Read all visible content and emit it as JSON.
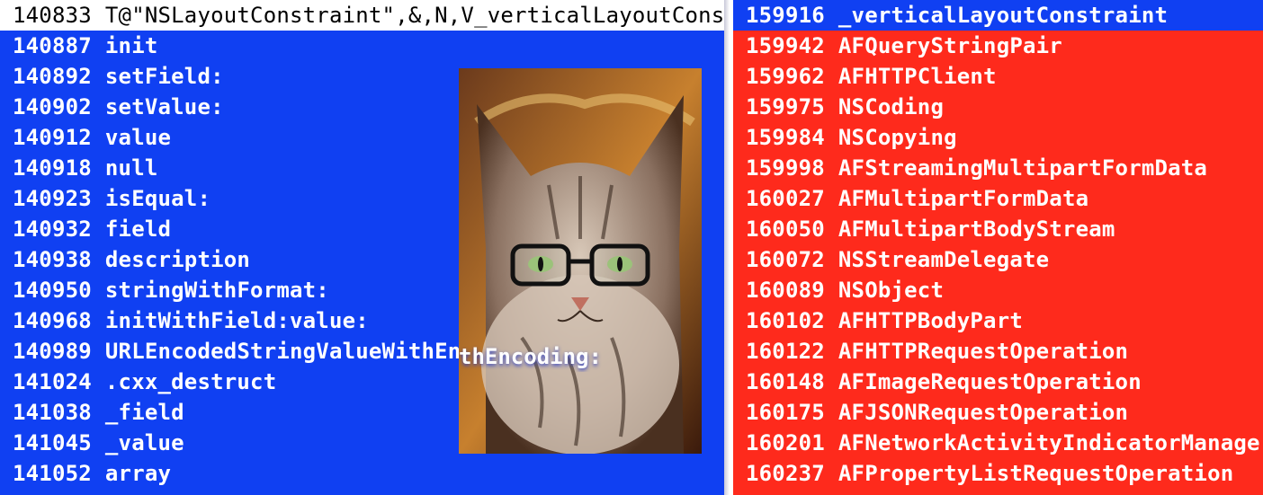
{
  "left_list": {
    "rows": [
      {
        "offset": "140833",
        "symbol": "T@\"NSLayoutConstraint\",&,N,V_verticalLayoutConstraint"
      },
      {
        "offset": "140887",
        "symbol": "init"
      },
      {
        "offset": "140892",
        "symbol": "setField:"
      },
      {
        "offset": "140902",
        "symbol": "setValue:"
      },
      {
        "offset": "140912",
        "symbol": "value"
      },
      {
        "offset": "140918",
        "symbol": "null"
      },
      {
        "offset": "140923",
        "symbol": "isEqual:"
      },
      {
        "offset": "140932",
        "symbol": "field"
      },
      {
        "offset": "140938",
        "symbol": "description"
      },
      {
        "offset": "140950",
        "symbol": "stringWithFormat:"
      },
      {
        "offset": "140968",
        "symbol": "initWithField:value:"
      },
      {
        "offset": "140989",
        "symbol": "URLEncodedStringValueWithEncoding:"
      },
      {
        "offset": "141024",
        "symbol": ".cxx_destruct"
      },
      {
        "offset": "141038",
        "symbol": "_field"
      },
      {
        "offset": "141045",
        "symbol": "_value"
      },
      {
        "offset": "141052",
        "symbol": "array"
      }
    ],
    "background": "#1040f2"
  },
  "right_list": {
    "rows": [
      {
        "offset": "159916",
        "symbol": "_verticalLayoutConstraint"
      },
      {
        "offset": "159942",
        "symbol": "AFQueryStringPair"
      },
      {
        "offset": "159962",
        "symbol": "AFHTTPClient"
      },
      {
        "offset": "159975",
        "symbol": "NSCoding"
      },
      {
        "offset": "159984",
        "symbol": "NSCopying"
      },
      {
        "offset": "159998",
        "symbol": "AFStreamingMultipartFormData"
      },
      {
        "offset": "160027",
        "symbol": "AFMultipartFormData"
      },
      {
        "offset": "160050",
        "symbol": "AFMultipartBodyStream"
      },
      {
        "offset": "160072",
        "symbol": "NSStreamDelegate"
      },
      {
        "offset": "160089",
        "symbol": "NSObject"
      },
      {
        "offset": "160102",
        "symbol": "AFHTTPBodyPart"
      },
      {
        "offset": "160122",
        "symbol": "AFHTTPRequestOperation"
      },
      {
        "offset": "160148",
        "symbol": "AFImageRequestOperation"
      },
      {
        "offset": "160175",
        "symbol": "AFJSONRequestOperation"
      },
      {
        "offset": "160201",
        "symbol": "AFNetworkActivityIndicatorManager"
      },
      {
        "offset": "160237",
        "symbol": "AFPropertyListRequestOperation"
      }
    ],
    "background": "#fe2a1c"
  },
  "overlay": {
    "image": "cat-with-glasses-photo",
    "text": "thEncoding:"
  }
}
